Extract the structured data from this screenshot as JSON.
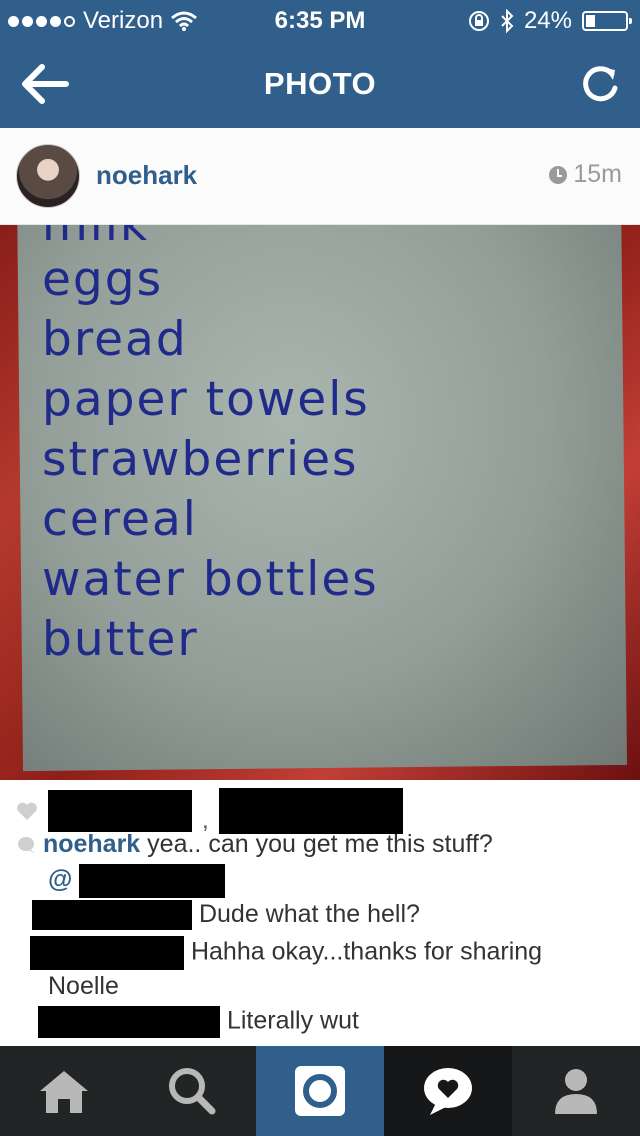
{
  "status_bar": {
    "carrier": "Verizon",
    "time": "6:35 PM",
    "battery_percent": "24%",
    "battery_level": 0.24,
    "signal_bars": 4
  },
  "nav": {
    "title": "PHOTO",
    "back_icon": "back-arrow-icon",
    "refresh_icon": "refresh-icon"
  },
  "post": {
    "username": "noehark",
    "time_ago": "15m",
    "photo_list": [
      "milk",
      "eggs",
      "bread",
      "paper towels",
      "strawberries",
      "cereal",
      "water bottles",
      "butter"
    ]
  },
  "comments": {
    "caption_user": "noehark",
    "caption_text": "yea.. can you get me this stuff?",
    "caption_mention": "@",
    "items": [
      {
        "text": "Dude what the hell?"
      },
      {
        "text": "Hahha okay...thanks for sharing"
      },
      {
        "text": "Noelle"
      },
      {
        "text": "Literally wut"
      }
    ]
  },
  "tabbar": {
    "items": [
      "home-icon",
      "search-icon",
      "camera-icon",
      "activity-icon",
      "profile-icon"
    ]
  },
  "colors": {
    "brand": "#2f5f8a",
    "tabbar": "#222526"
  }
}
